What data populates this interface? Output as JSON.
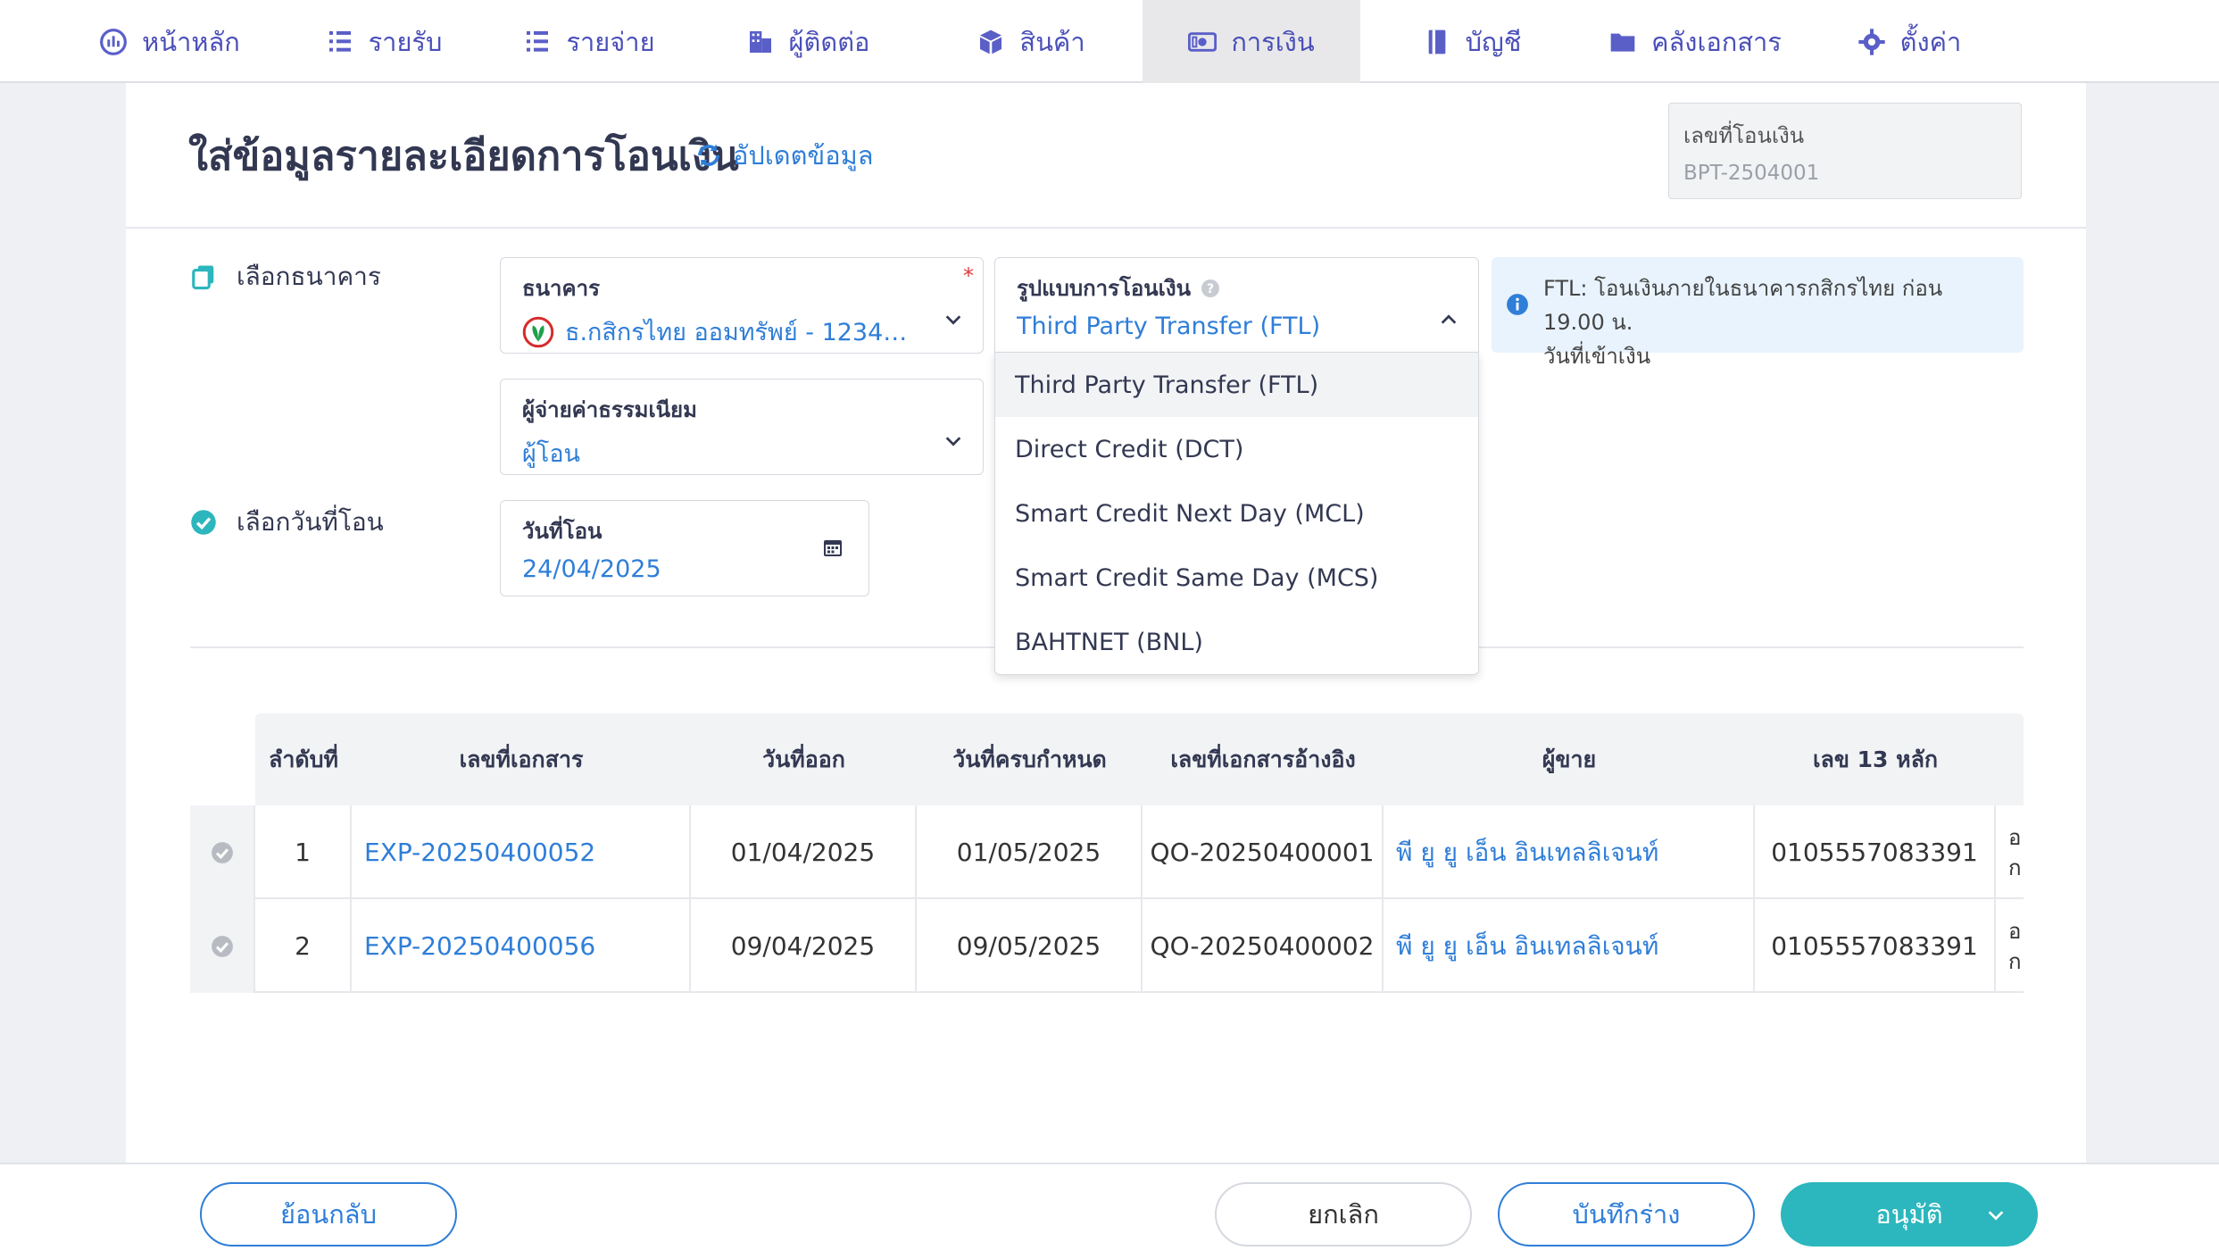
{
  "nav": [
    {
      "label": "หน้าหลัก",
      "icon": "dashboard-icon"
    },
    {
      "label": "รายรับ",
      "icon": "income-icon"
    },
    {
      "label": "รายจ่าย",
      "icon": "expense-icon"
    },
    {
      "label": "ผู้ติดต่อ",
      "icon": "building-icon"
    },
    {
      "label": "สินค้า",
      "icon": "box-icon"
    },
    {
      "label": "การเงิน",
      "icon": "money-icon",
      "active": true
    },
    {
      "label": "บัญชี",
      "icon": "ledger-icon"
    },
    {
      "label": "คลังเอกสาร",
      "icon": "folder-icon"
    },
    {
      "label": "ตั้งค่า",
      "icon": "gear-icon"
    }
  ],
  "header": {
    "title": "ใส่ข้อมูลรายละเอียดการโอนเงิน",
    "refresh_label": "อัปเดตข้อมูล",
    "docno_label": "เลขที่โอนเงิน",
    "docno_value": "BPT-2504001"
  },
  "sections": {
    "bank": "เลือกธนาคาร",
    "date": "เลือกวันที่โอน"
  },
  "fields": {
    "bank": {
      "label": "ธนาคาร",
      "value": "ธ.กสิกรไทย ออมทรัพย์ - 12345..."
    },
    "fee_payer": {
      "label": "ผู้จ่ายค่าธรรมเนียม",
      "value": "ผู้โอน"
    },
    "transfer_date": {
      "label": "วันที่โอน",
      "value": "24/04/2025"
    },
    "transfer_type": {
      "label": "รูปแบบการโอนเงิน",
      "value": "Third Party Transfer (FTL)"
    }
  },
  "dropdown_options": [
    "Third Party Transfer (FTL)",
    "Direct Credit (DCT)",
    "Smart Credit Next Day (MCL)",
    "Smart Credit Same Day (MCS)",
    "BAHTNET (BNL)"
  ],
  "info": {
    "line1": "FTL: โอนเงินภายในธนาคารกสิกรไทย ก่อน 19.00 น.",
    "line2": "วันที่เข้าเงิน"
  },
  "table": {
    "headers": [
      "ลำดับที่",
      "เลขที่เอกสาร",
      "วันที่ออก",
      "วันที่ครบกำหนด",
      "เลขที่เอกสารอ้างอิง",
      "ผู้ขาย",
      "เลข 13 หลัก"
    ],
    "rows": [
      {
        "no": "1",
        "doc": "EXP-20250400052",
        "issue": "01/04/2025",
        "due": "01/05/2025",
        "ref": "QO-20250400001",
        "vendor": "พี ยู ยู เอ็น อินเทลลิเจนท์",
        "tax": "0105557083391",
        "trunc1": "อ",
        "trunc2": "ก"
      },
      {
        "no": "2",
        "doc": "EXP-20250400056",
        "issue": "09/04/2025",
        "due": "09/05/2025",
        "ref": "QO-20250400002",
        "vendor": "พี ยู ยู เอ็น อินเทลลิเจนท์",
        "tax": "0105557083391",
        "trunc1": "อ",
        "trunc2": "ก"
      }
    ]
  },
  "buttons": {
    "back": "ย้อนกลับ",
    "cancel": "ยกเลิก",
    "draft": "บันทึกร่าง",
    "approve": "อนุมัติ"
  },
  "colors": {
    "accent": "#2f7ed8",
    "nav": "#4a4fb8",
    "approve": "#2cb6bd"
  }
}
